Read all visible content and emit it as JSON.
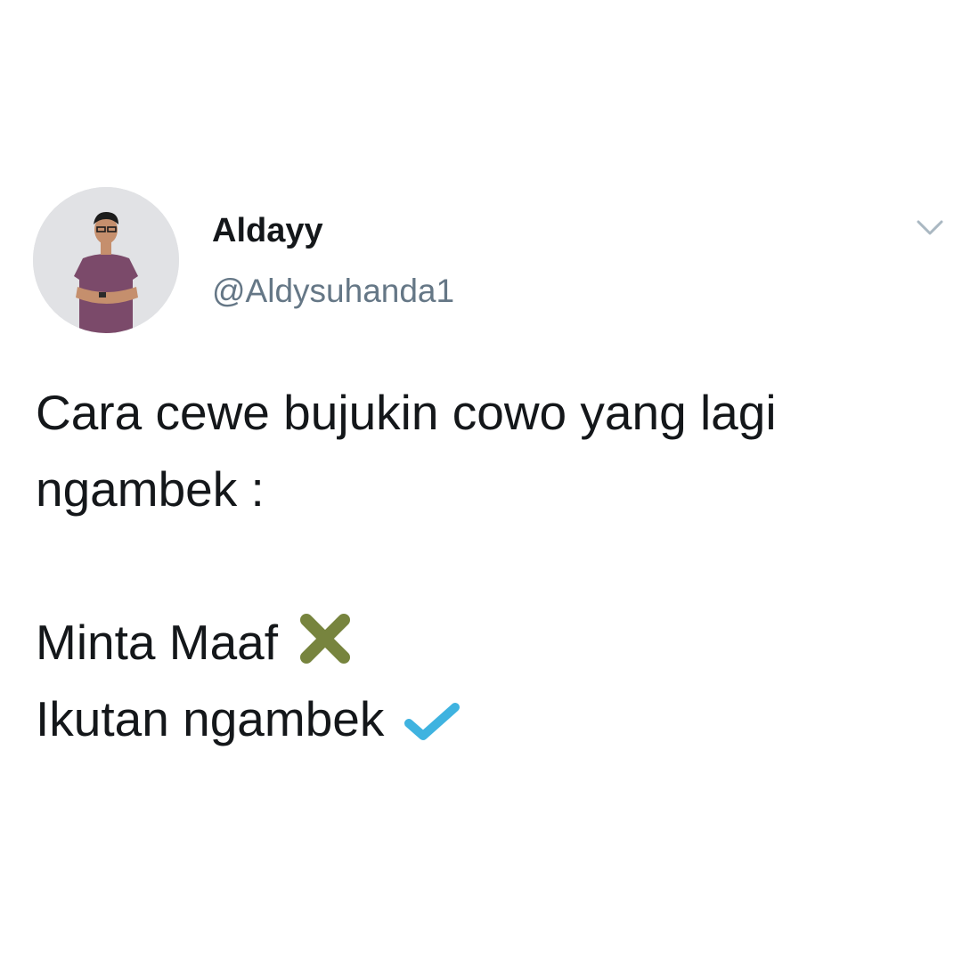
{
  "tweet": {
    "author": {
      "display_name": "Aldayy",
      "handle": "@Aldysuhanda1",
      "avatar_icon": "profile-photo"
    },
    "menu_icon": "chevron-down-icon",
    "text": {
      "line1": "Cara cewe bujukin cowo yang lagi",
      "line2": "ngambek :",
      "line3": "Minta Maaf",
      "line4": "Ikutan ngambek"
    },
    "emoji": {
      "cross": {
        "name": "cross-mark-icon",
        "color": "#77843e"
      },
      "check": {
        "name": "check-mark-icon",
        "color": "#3fb3e0"
      }
    }
  },
  "colors": {
    "background": "#ffffff",
    "name": "#14171a",
    "handle": "#657786",
    "caret": "#aab8c2"
  }
}
